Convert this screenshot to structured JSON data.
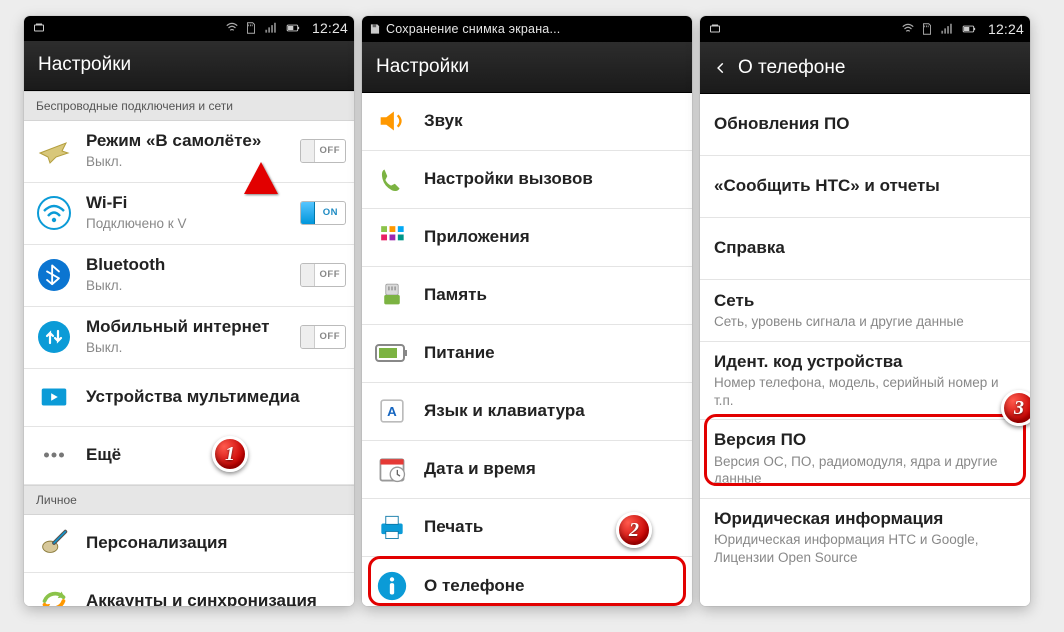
{
  "time": "12:24",
  "phone1": {
    "title": "Настройки",
    "section1": "Беспроводные подключения и сети",
    "section2": "Личное",
    "items": {
      "airplane": {
        "title": "Режим «В самолёте»",
        "sub": "Выкл.",
        "toggle": "OFF"
      },
      "wifi": {
        "title": "Wi-Fi",
        "sub": "Подключено к V",
        "toggle": "ON"
      },
      "bt": {
        "title": "Bluetooth",
        "sub": "Выкл.",
        "toggle": "OFF"
      },
      "mobiledata": {
        "title": "Мобильный интернет",
        "sub": "Выкл.",
        "toggle": "OFF"
      },
      "multimedia": {
        "title": "Устройства мультимедиа"
      },
      "more": {
        "title": "Ещё"
      },
      "personalize": {
        "title": "Персонализация"
      },
      "accounts": {
        "title": "Аккаунты и синхронизация"
      }
    }
  },
  "phone2": {
    "title": "Настройки",
    "saving": "Сохранение снимка экрана...",
    "items": {
      "sound": "Звук",
      "calls": "Настройки вызовов",
      "apps": "Приложения",
      "storage": "Память",
      "power": "Питание",
      "lang": "Язык и клавиатура",
      "date": "Дата и время",
      "print": "Печать",
      "about": "О телефоне"
    }
  },
  "phone3": {
    "title": "О телефоне",
    "items": {
      "update": {
        "title": "Обновления ПО"
      },
      "tellhtc": {
        "title": "«Сообщить HTC» и отчеты"
      },
      "help": {
        "title": "Справка"
      },
      "network": {
        "title": "Сеть",
        "sub": "Сеть, уровень сигнала и другие данные"
      },
      "identity": {
        "title": "Идент. код устройства",
        "sub": "Номер телефона, модель, серийный номер и т.п."
      },
      "swver": {
        "title": "Версия ПО",
        "sub": "Версия ОС, ПО, радиомодуля, ядра и другие данные"
      },
      "legal": {
        "title": "Юридическая информация",
        "sub": "Юридическая информация HTC и Google, Лицензии Open Source"
      }
    }
  },
  "badges": {
    "b1": "1",
    "b2": "2",
    "b3": "3"
  }
}
